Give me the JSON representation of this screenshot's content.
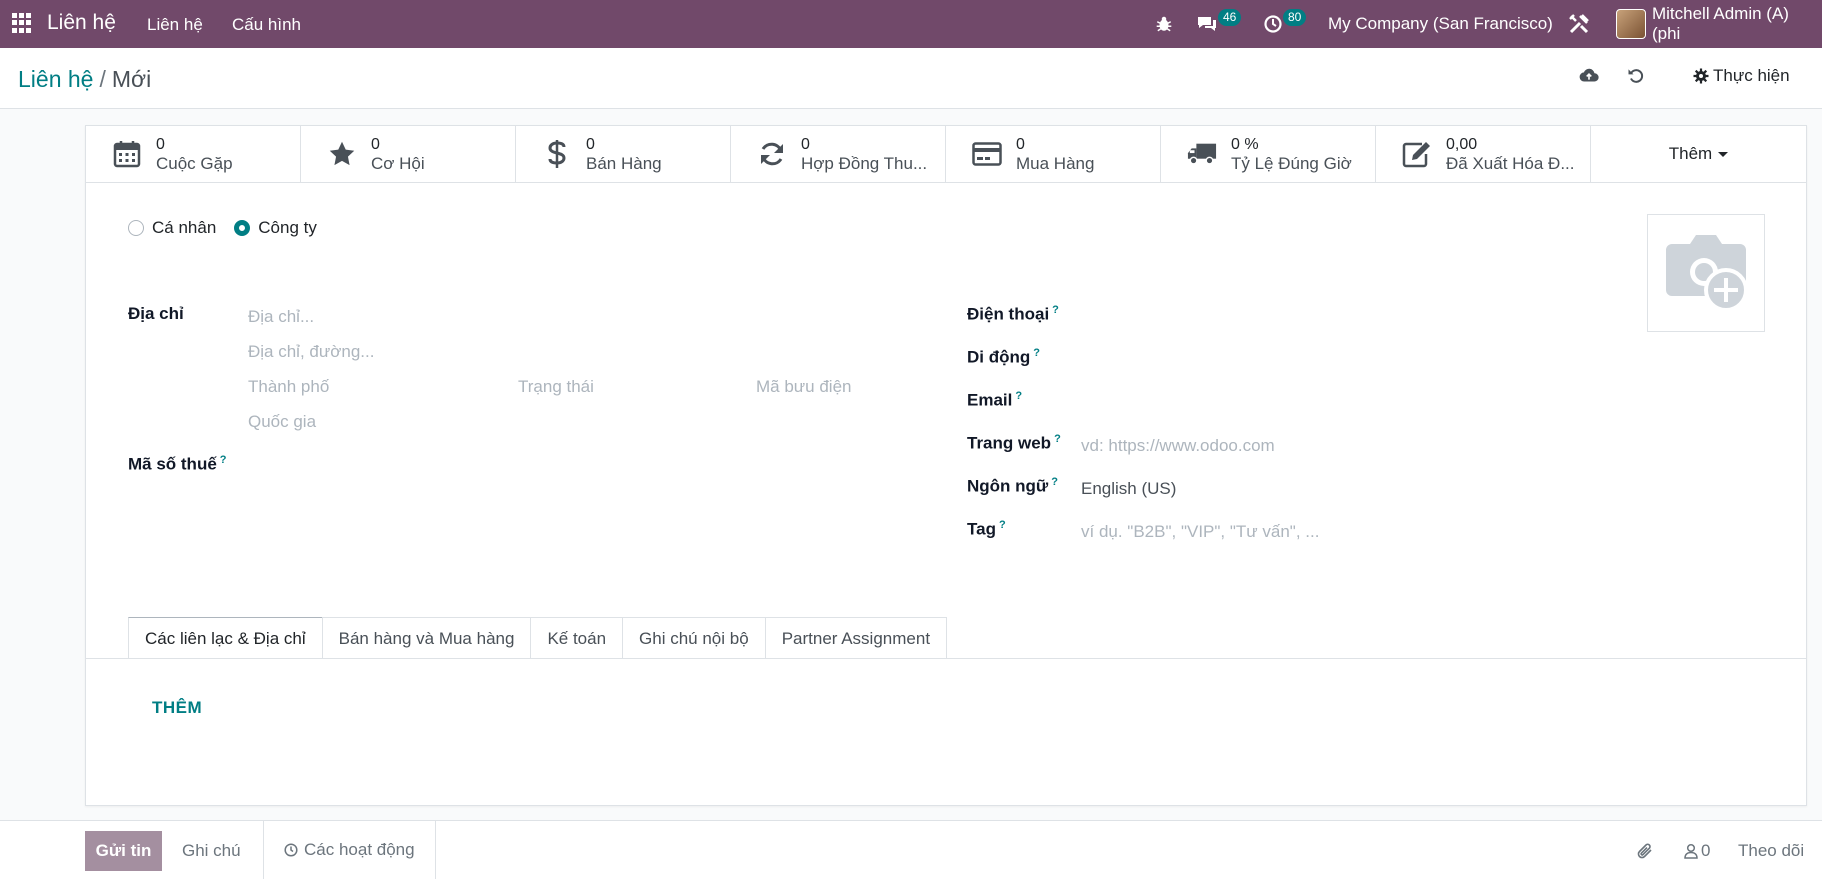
{
  "navbar": {
    "app_title": "Liên hệ",
    "menus": [
      "Liên hệ",
      "Cấu hình"
    ],
    "messages_count": "46",
    "activities_count": "80",
    "company": "My Company (San Francisco)",
    "user": "Mitchell Admin (A) (phi"
  },
  "breadcrumb": {
    "parent": "Liên hệ",
    "separator": "/",
    "current": "Mới"
  },
  "control_panel": {
    "action_label": "Thực hiện"
  },
  "stat_buttons": [
    {
      "value": "0",
      "label": "Cuộc Gặp",
      "icon": "calendar-icon"
    },
    {
      "value": "0",
      "label": "Cơ Hội",
      "icon": "star-icon"
    },
    {
      "value": "0",
      "label": "Bán Hàng",
      "icon": "dollar-icon"
    },
    {
      "value": "0",
      "label": "Hợp Đồng Thu...",
      "icon": "refresh-icon"
    },
    {
      "value": "0",
      "label": "Mua Hàng",
      "icon": "credit-card-icon"
    },
    {
      "value": "0 %",
      "label": "Tỷ Lệ Đúng Giờ",
      "icon": "truck-icon"
    },
    {
      "value": "0,00",
      "label": "Đã Xuất Hóa Đ...",
      "icon": "pencil-square-icon"
    }
  ],
  "stat_more": "Thêm",
  "company_type": {
    "options": [
      "Cá nhân",
      "Công ty"
    ],
    "selected": "Công ty"
  },
  "address": {
    "label": "Địa chỉ",
    "street_placeholder": "Địa chỉ...",
    "street2_placeholder": "Địa chỉ, đường...",
    "city_placeholder": "Thành phố",
    "state_placeholder": "Trạng thái",
    "zip_placeholder": "Mã bưu điện",
    "country_placeholder": "Quốc gia"
  },
  "tax_id": {
    "label": "Mã số thuế"
  },
  "contact_fields": {
    "phone_label": "Điện thoại",
    "mobile_label": "Di động",
    "email_label": "Email",
    "website_label": "Trang web",
    "website_placeholder": "vd: https://www.odoo.com",
    "language_label": "Ngôn ngữ",
    "language_value": "English (US)",
    "tag_label": "Tag",
    "tag_placeholder": "ví dụ. \"B2B\", \"VIP\", \"Tư vấn\", ..."
  },
  "help_marker": "?",
  "tabs": [
    "Các liên lạc & Địa chỉ",
    "Bán hàng và Mua hàng",
    "Kế toán",
    "Ghi chú nội bộ",
    "Partner Assignment"
  ],
  "active_tab": "Các liên lạc & Địa chỉ",
  "add_label": "THÊM",
  "chatter": {
    "send_label": "Gửi tin",
    "note_label": "Ghi chú",
    "activities_label": "Các hoạt động",
    "followers_count": "0",
    "follow_label": "Theo dõi"
  },
  "colors": {
    "navbar": "#71496a",
    "accent": "#017e84",
    "send_button": "#a48fa0"
  }
}
